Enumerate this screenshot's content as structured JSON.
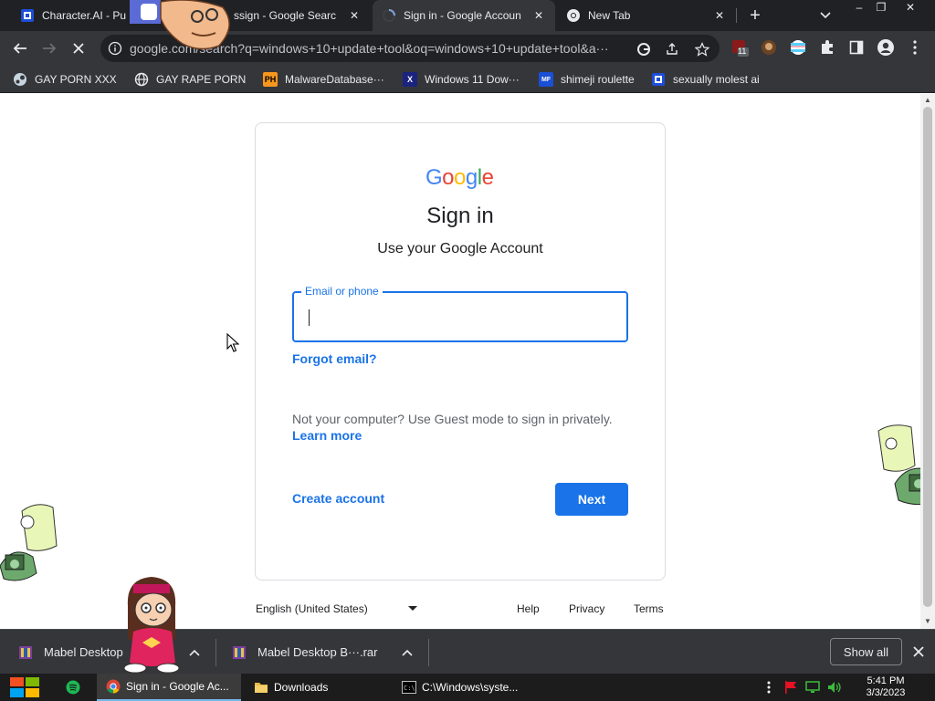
{
  "browser": {
    "tabs": [
      {
        "title": "Character.AI - Pu",
        "icon": "character-ai-icon",
        "active": false
      },
      {
        "title": "ssign - Google Searc",
        "icon": "google-icon",
        "active": false
      },
      {
        "title": "Sign in - Google Accoun",
        "icon": "loading-spinner-icon",
        "active": true
      },
      {
        "title": "New Tab",
        "icon": "chrome-icon",
        "active": false
      }
    ],
    "close_glyph": "✕",
    "newtab_glyph": "+",
    "window_controls": {
      "minimize": "–",
      "restore": "❐",
      "close": "✕"
    },
    "address_bar": {
      "url": "google.com/search?q=windows+10+update+tool&oq=windows+10+update+tool&a···"
    },
    "extension_badge": "11",
    "bookmarks": [
      {
        "label": "GAY PORN XXX",
        "icon": "steam-icon"
      },
      {
        "label": "GAY RAPE PORN",
        "icon": "globe-icon"
      },
      {
        "label": "MalwareDatabase···",
        "icon": "ph-icon",
        "icon_text": "PH"
      },
      {
        "label": "Windows 11 Dow···",
        "icon": "x-icon",
        "icon_text": "X"
      },
      {
        "label": "shimeji roulette",
        "icon": "mf-icon",
        "icon_text": "MF"
      },
      {
        "label": "sexually molest ai",
        "icon": "character-ai-icon"
      }
    ]
  },
  "signin": {
    "logo_letters": [
      {
        "ch": "G",
        "color": "#4285F4"
      },
      {
        "ch": "o",
        "color": "#EA4335"
      },
      {
        "ch": "o",
        "color": "#FBBC05"
      },
      {
        "ch": "g",
        "color": "#4285F4"
      },
      {
        "ch": "l",
        "color": "#34A853"
      },
      {
        "ch": "e",
        "color": "#EA4335"
      }
    ],
    "title": "Sign in",
    "subtitle": "Use your Google Account",
    "email_label": "Email or phone",
    "email_value": "",
    "forgot_email": "Forgot email?",
    "guest_text": "Not your computer? Use Guest mode to sign in privately.",
    "learn_more": "Learn more",
    "create_account": "Create account",
    "next": "Next"
  },
  "footer": {
    "language": "English (United States)",
    "links": [
      "Help",
      "Privacy",
      "Terms"
    ]
  },
  "downloads": {
    "items": [
      {
        "name": "Mabel Desktop",
        "icon": "winrar-icon"
      },
      {
        "name": "Mabel Desktop B···.rar",
        "icon": "winrar-icon"
      }
    ],
    "show_all": "Show all"
  },
  "taskbar": {
    "tasks": [
      {
        "label": "Sign in - Google Ac...",
        "icon": "chrome-icon",
        "active": true
      },
      {
        "label": "Downloads",
        "icon": "folder-icon",
        "active": false
      },
      {
        "label": "C:\\Windows\\syste...",
        "icon": "cmd-icon",
        "active": false
      }
    ],
    "time": "5:41 PM",
    "date": "3/3/2023"
  },
  "colors": {
    "chrome_dark": "#202124",
    "chrome_mid": "#35363a",
    "google_blue": "#1a73e8",
    "text_primary": "#202124",
    "text_secondary": "#5f6368"
  }
}
